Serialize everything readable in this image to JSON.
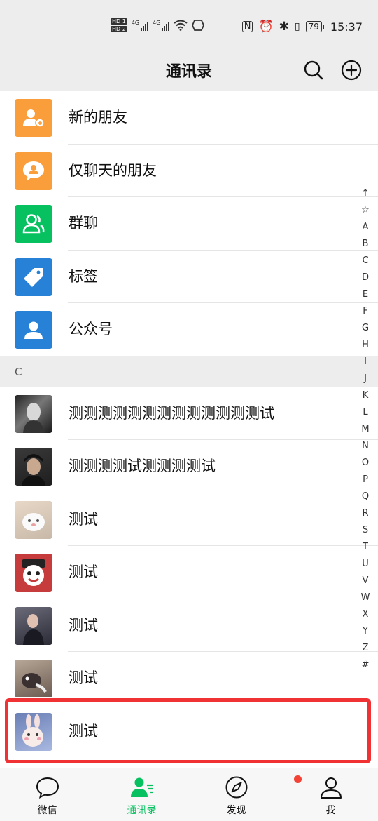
{
  "status_bar": {
    "hd1": "HD 1",
    "hd2": "HD 2",
    "net1": "4G",
    "net2": "4G",
    "battery": "79",
    "time": "15:37"
  },
  "header": {
    "title": "通讯录",
    "search_icon": "search-icon",
    "add_icon": "plus-circle-icon"
  },
  "features": [
    {
      "label": "新的朋友",
      "icon": "add-friend-icon",
      "color": "#fa9d3b"
    },
    {
      "label": "仅聊天的朋友",
      "icon": "chat-only-icon",
      "color": "#fa9d3b"
    },
    {
      "label": "群聊",
      "icon": "group-icon",
      "color": "#07c160"
    },
    {
      "label": "标签",
      "icon": "tag-icon",
      "color": "#2782d7"
    },
    {
      "label": "公众号",
      "icon": "official-account-icon",
      "color": "#2782d7"
    }
  ],
  "section_header": "C",
  "contacts": [
    {
      "label": "测测测测测测测测测测测测测试",
      "avatar": "avatar-1"
    },
    {
      "label": "测测测测试测测测测试",
      "avatar": "avatar-2"
    },
    {
      "label": "测试",
      "avatar": "avatar-3"
    },
    {
      "label": "测试",
      "avatar": "avatar-4"
    },
    {
      "label": "测试",
      "avatar": "avatar-5"
    },
    {
      "label": "测试",
      "avatar": "avatar-6"
    },
    {
      "label": "测试",
      "avatar": "avatar-7"
    }
  ],
  "index_letters": [
    "↑",
    "☆",
    "A",
    "B",
    "C",
    "D",
    "E",
    "F",
    "G",
    "H",
    "I",
    "J",
    "K",
    "L",
    "M",
    "N",
    "O",
    "P",
    "Q",
    "R",
    "S",
    "T",
    "U",
    "V",
    "W",
    "X",
    "Y",
    "Z",
    "#"
  ],
  "tabs": [
    {
      "label": "微信",
      "icon": "chat-bubble-icon",
      "active": false
    },
    {
      "label": "通讯录",
      "icon": "contacts-icon",
      "active": true
    },
    {
      "label": "发现",
      "icon": "compass-icon",
      "active": false,
      "badge": true
    },
    {
      "label": "我",
      "icon": "person-icon",
      "active": false
    }
  ],
  "colors": {
    "accent": "#07c160",
    "highlight_border": "#f03235",
    "background": "#ededed"
  }
}
